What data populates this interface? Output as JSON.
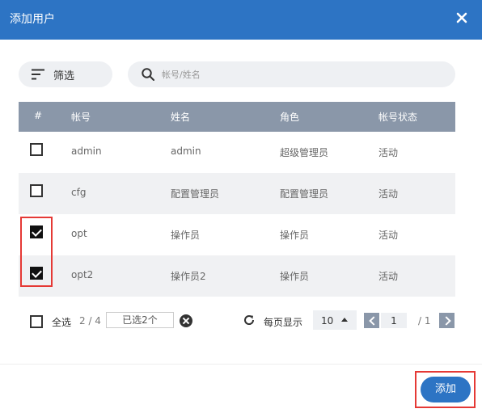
{
  "dialog": {
    "title": "添加用户"
  },
  "toolbar": {
    "filter_label": "筛选",
    "search_placeholder": "帐号/姓名"
  },
  "table": {
    "columns": [
      "#",
      "帐号",
      "姓名",
      "角色",
      "帐号状态"
    ],
    "rows": [
      {
        "checked": false,
        "account": "admin",
        "name": "admin",
        "role": "超级管理员",
        "status": "活动"
      },
      {
        "checked": false,
        "account": "cfg",
        "name": "配置管理员",
        "role": "配置管理员",
        "status": "活动"
      },
      {
        "checked": true,
        "account": "opt",
        "name": "操作员",
        "role": "操作员",
        "status": "活动"
      },
      {
        "checked": true,
        "account": "opt2",
        "name": "操作员2",
        "role": "操作员",
        "status": "活动"
      }
    ]
  },
  "pager": {
    "select_all_label": "全选",
    "page_count": "2 / 4",
    "selected_text": "已选2个",
    "per_page_label": "每页显示",
    "page_size": "10",
    "current_page": "1",
    "total_pages": "/ 1"
  },
  "footer": {
    "add_label": "添加"
  },
  "colors": {
    "header": "#2d74c4",
    "table_header": "#8a97a9",
    "highlight": "#e53935"
  },
  "icons": {
    "close": "close-icon",
    "filter": "filter-icon",
    "search": "search-icon",
    "refresh": "refresh-icon"
  }
}
